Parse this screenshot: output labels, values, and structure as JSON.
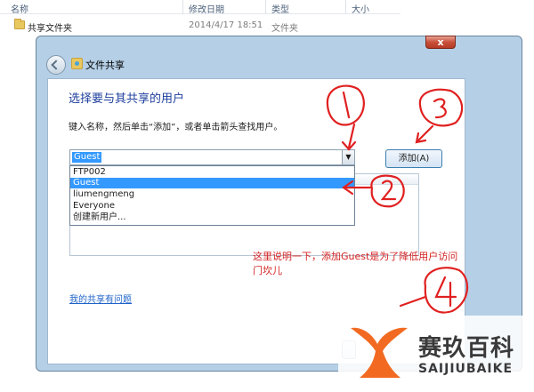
{
  "explorer": {
    "columns": [
      "名称",
      "修改日期",
      "类型",
      "大小"
    ],
    "row": {
      "name": "共享文件夹",
      "date": "2014/4/17 18:51",
      "type": "文件夹"
    }
  },
  "dialog": {
    "title": "文件共享",
    "close_label": "x",
    "heading": "选择要与其共享的用户",
    "instruction": "键入名称，然后单击“添加”，或者单击箭头查找用户。",
    "combo_value": "Guest",
    "add_label": "添加(A)",
    "dropdown_options": [
      "FTP002",
      "Guest",
      "liumengmeng",
      "Everyone",
      "创建新用户..."
    ],
    "dropdown_selected_index": 1,
    "note": "这里说明一下，添加Guest是为了降低用户访问门坎儿",
    "problem_link": "我的共享有问题"
  },
  "annotations": {
    "color": "#e02020",
    "marks": [
      "1",
      "2",
      "3",
      "4"
    ]
  },
  "watermark": {
    "name": "赛玖百科",
    "sub": "SAIJIUBAIKE",
    "brand_color": "#f26a21"
  },
  "colors": {
    "accent": "#3399ff",
    "link": "#1e63c8",
    "heading": "#1e3f9e"
  }
}
